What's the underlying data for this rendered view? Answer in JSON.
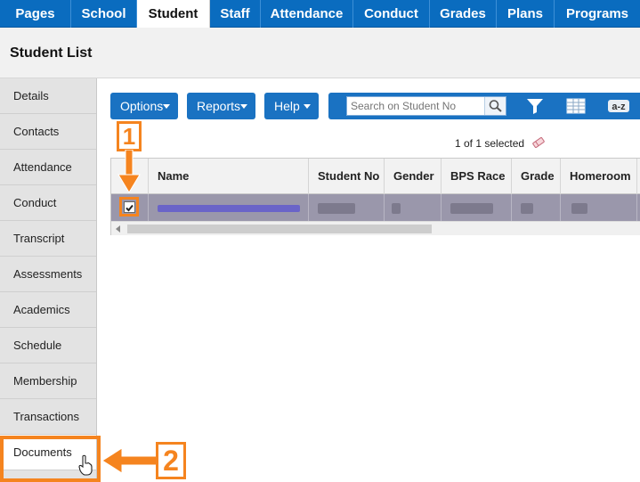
{
  "topnav": {
    "tabs": [
      {
        "label": "Pages"
      },
      {
        "label": "School"
      },
      {
        "label": "Student"
      },
      {
        "label": "Staff"
      },
      {
        "label": "Attendance"
      },
      {
        "label": "Conduct"
      },
      {
        "label": "Grades"
      },
      {
        "label": "Plans"
      },
      {
        "label": "Programs"
      }
    ],
    "active": "Student"
  },
  "header": {
    "title": "Student List"
  },
  "sidebar": {
    "items": [
      {
        "label": "Details"
      },
      {
        "label": "Contacts"
      },
      {
        "label": "Attendance"
      },
      {
        "label": "Conduct"
      },
      {
        "label": "Transcript"
      },
      {
        "label": "Assessments"
      },
      {
        "label": "Academics"
      },
      {
        "label": "Schedule"
      },
      {
        "label": "Membership"
      },
      {
        "label": "Transactions"
      },
      {
        "label": "Documents"
      }
    ],
    "highlighted": "Documents"
  },
  "toolbar": {
    "options_label": "Options",
    "reports_label": "Reports",
    "help_label": "Help",
    "search_placeholder": "Search on Student No",
    "icons": [
      "search-icon",
      "filter-icon",
      "grid-view-icon",
      "sort-az-icon"
    ],
    "sort_label": "a-z"
  },
  "selection": {
    "text": "1 of 1 selected"
  },
  "grid": {
    "columns": [
      "Name",
      "Student No",
      "Gender",
      "BPS Race",
      "Grade",
      "Homeroom"
    ],
    "row_checked": true
  },
  "callouts": {
    "step1": "1",
    "step2": "2"
  },
  "colors": {
    "nav_blue": "#0a6cbf",
    "button_blue": "#1a72c2",
    "callout_orange": "#f5841f",
    "selected_row": "#9a97ab"
  }
}
